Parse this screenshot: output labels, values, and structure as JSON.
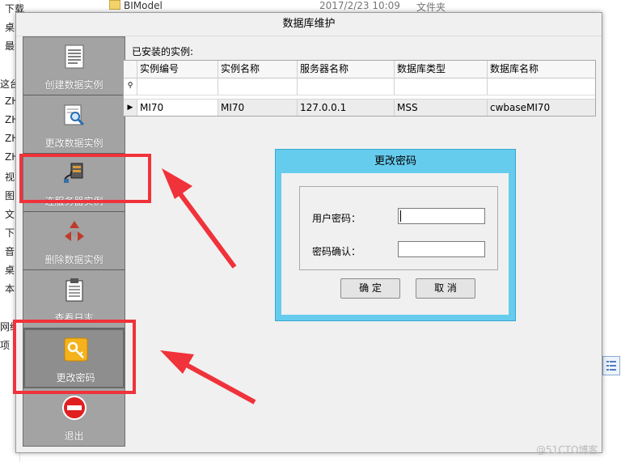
{
  "background": {
    "tree_items": [
      "下载",
      "桌",
      "最",
      "这台",
      "ZH",
      "ZH",
      "ZH",
      "ZH",
      "视",
      "图",
      "文",
      "下",
      "音",
      "桌",
      "本",
      "网络",
      "项"
    ],
    "file": {
      "name": "BIModel",
      "date": "2017/2/23 10:09",
      "type": "文件夹"
    }
  },
  "dialog": {
    "title": "数据库维护"
  },
  "tools": [
    {
      "label": "创建数据实例",
      "icon": "document-list-icon"
    },
    {
      "label": "更改数据实例",
      "icon": "document-search-icon"
    },
    {
      "label": "连服务器实例",
      "icon": "server-connect-icon"
    },
    {
      "label": "删除数据实例",
      "icon": "recycle-delete-icon"
    },
    {
      "label": "查看日志",
      "icon": "clipboard-log-icon"
    },
    {
      "label": "更改密码",
      "icon": "key-icon"
    },
    {
      "label": "退出",
      "icon": "exit-stop-icon"
    }
  ],
  "instances": {
    "title": "已安装的实例:",
    "columns": [
      "实例编号",
      "实例名称",
      "服务器名称",
      "数据库类型",
      "数据库名称"
    ],
    "rows": [
      [
        "MI70",
        "MI70",
        "127.0.0.1",
        "MSS",
        "cwbaseMI70"
      ]
    ]
  },
  "change_password": {
    "title": "更改密码",
    "password_label": "用户密码：",
    "confirm_label": "密码确认：",
    "password_value": "",
    "confirm_value": "",
    "ok_label": "确 定",
    "cancel_label": "取 消"
  },
  "watermark": "@51CTO博客",
  "colors": {
    "annotation": "#f0323a",
    "dialog_header": "#66ccee",
    "tool_panel": "#9c9c9c"
  }
}
